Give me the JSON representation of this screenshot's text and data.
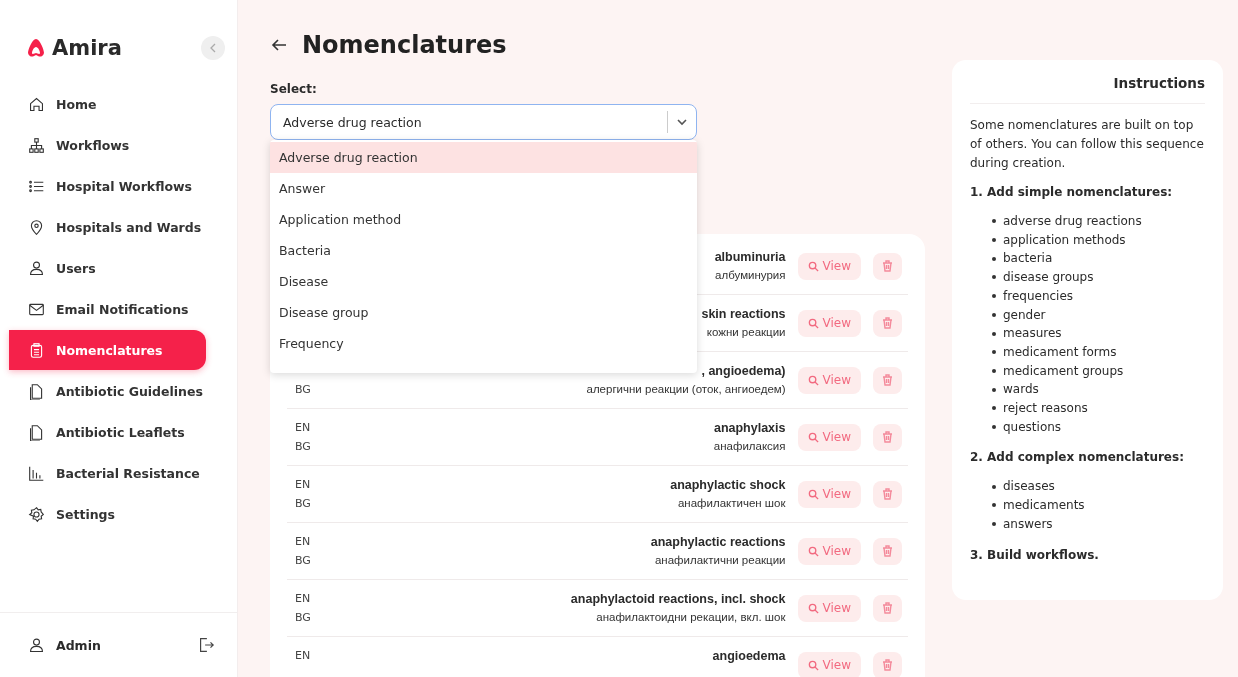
{
  "brand": {
    "name": "Amira"
  },
  "sidebar": {
    "items": [
      {
        "label": "Home",
        "selected": false
      },
      {
        "label": "Workflows",
        "selected": false
      },
      {
        "label": "Hospital Workflows",
        "selected": false
      },
      {
        "label": "Hospitals and Wards",
        "selected": false
      },
      {
        "label": "Users",
        "selected": false
      },
      {
        "label": "Email Notifications",
        "selected": false
      },
      {
        "label": "Nomenclatures",
        "selected": true
      },
      {
        "label": "Antibiotic Guidelines",
        "selected": false
      },
      {
        "label": "Antibiotic Leaflets",
        "selected": false
      },
      {
        "label": "Bacterial Resistance",
        "selected": false
      },
      {
        "label": "Settings",
        "selected": false
      }
    ],
    "user": {
      "label": "Admin"
    }
  },
  "page": {
    "title": "Nomenclatures"
  },
  "select": {
    "label": "Select:",
    "value": "Adverse drug reaction",
    "expanded": true,
    "options": [
      {
        "label": "Adverse drug reaction",
        "selected": true
      },
      {
        "label": "Answer",
        "selected": false
      },
      {
        "label": "Application method",
        "selected": false
      },
      {
        "label": "Bacteria",
        "selected": false
      },
      {
        "label": "Disease",
        "selected": false
      },
      {
        "label": "Disease group",
        "selected": false
      },
      {
        "label": "Frequency",
        "selected": false
      }
    ]
  },
  "rows": [
    {
      "en": "albuminuria",
      "bg": "албуминурия",
      "view": "View"
    },
    {
      "en": "skin reactions",
      "bg": "кожни реакции",
      "view": "View"
    },
    {
      "bg_label": "BG",
      "en": ", angioedema)",
      "bg": "алергични реакции (оток, ангиоедем)",
      "view": "View"
    },
    {
      "en_label": "EN",
      "bg_label": "BG",
      "en": "anaphylaxis",
      "bg": "анафилаксия",
      "view": "View"
    },
    {
      "en_label": "EN",
      "bg_label": "BG",
      "en": "anaphylactic shock",
      "bg": "анафилактичен шок",
      "view": "View"
    },
    {
      "en_label": "EN",
      "bg_label": "BG",
      "en": "anaphylactic reactions",
      "bg": "анафилактични реакции",
      "view": "View"
    },
    {
      "en_label": "EN",
      "bg_label": "BG",
      "en": "anaphylactoid reactions, incl. shock",
      "bg": "анафилактоидни рекации, вкл. шок",
      "view": "View"
    },
    {
      "en_label": "EN",
      "en": "angioedema",
      "view": "View"
    }
  ],
  "instructions": {
    "title": "Instructions",
    "intro": "Some nomenclatures are built on top of others. You can follow this sequence during creation.",
    "steps": [
      {
        "heading": "1. Add simple nomenclatures:",
        "items": [
          "adverse drug reactions",
          "application methods",
          "bacteria",
          "disease groups",
          "frequencies",
          "gender",
          "measures",
          "medicament forms",
          "medicament groups",
          "wards",
          "reject reasons",
          "questions"
        ]
      },
      {
        "heading": "2. Add complex nomenclatures:",
        "items": [
          "diseases",
          "medicaments",
          "answers"
        ]
      },
      {
        "heading": "3. Build workflows."
      }
    ]
  }
}
